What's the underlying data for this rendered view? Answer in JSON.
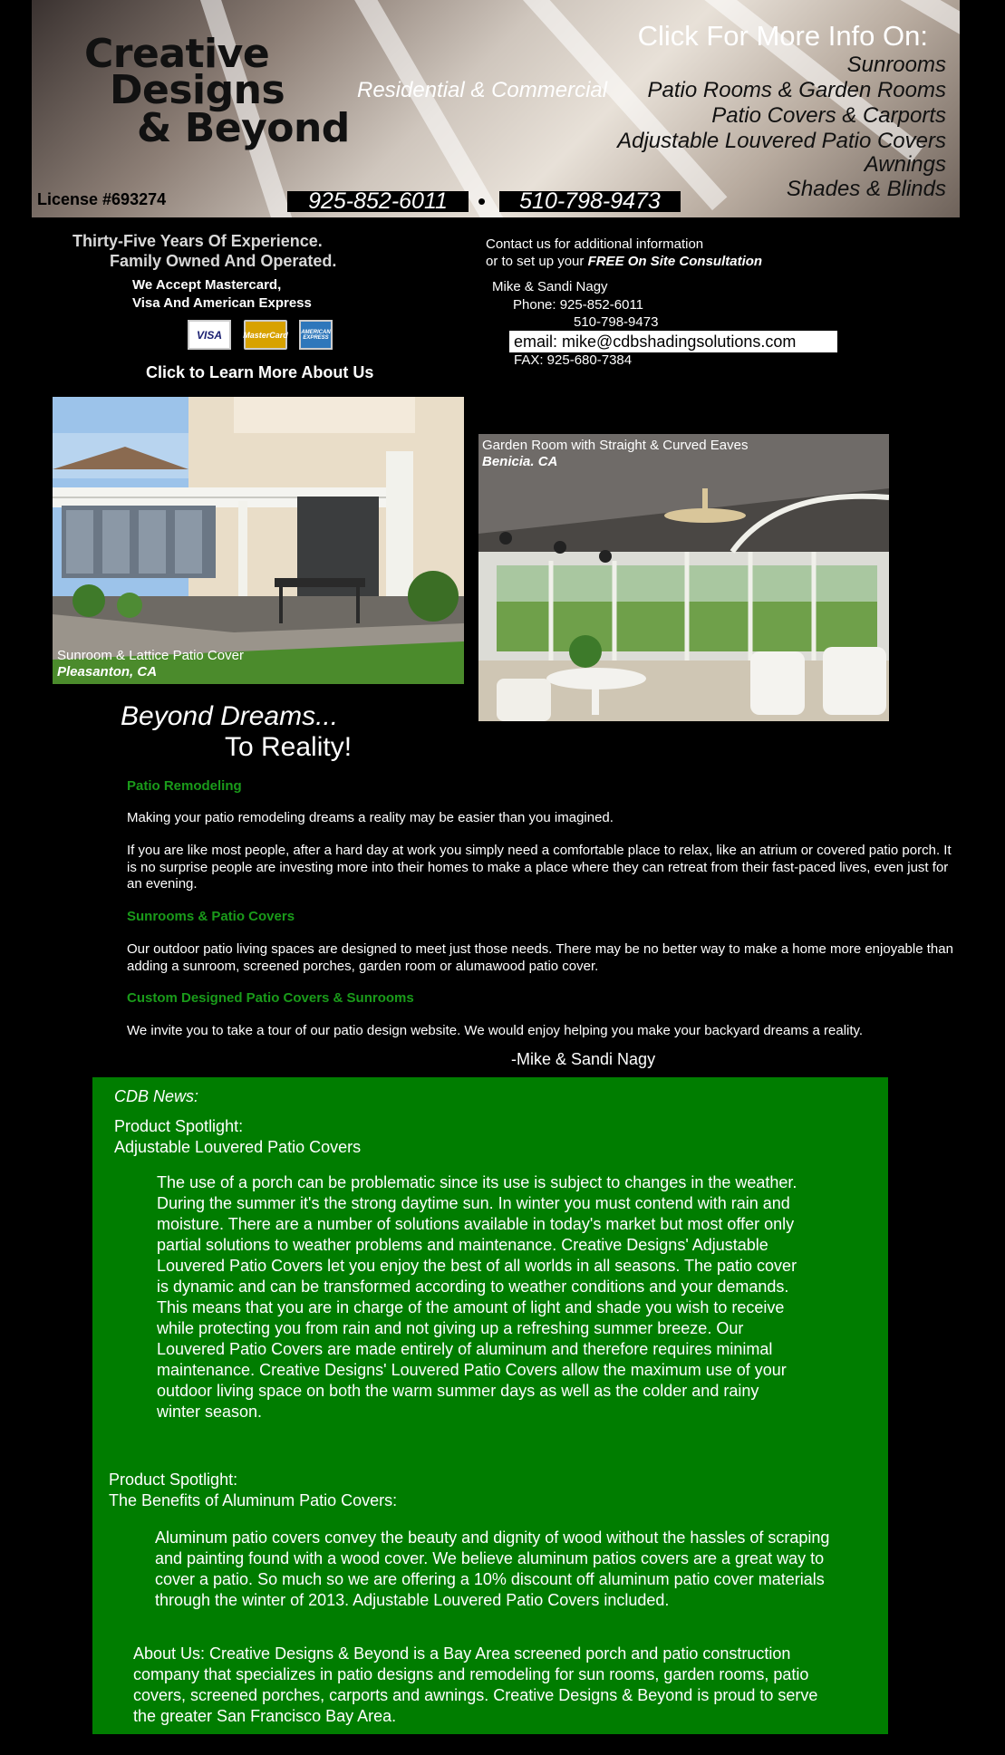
{
  "header": {
    "logo_line1": "Creative",
    "logo_line2": "Designs",
    "logo_line3": "& Beyond",
    "tagline": "Residential & Commercial",
    "more_info_title": "Click For More Info On:",
    "more_info_items": [
      "Sunrooms",
      "Patio Rooms & Garden Rooms",
      "Patio Covers & Carports",
      "Adjustable Louvered Patio Covers",
      "Awnings",
      "Shades & Blinds"
    ],
    "license": "License #693274",
    "phone1": "925-852-6011",
    "phone2": "510-798-9473",
    "separator": "•"
  },
  "intro": {
    "experience_line1": "Thirty-Five Years Of Experience.",
    "experience_line2": "Family Owned And Operated.",
    "cards_line1": "We Accept Mastercard,",
    "cards_line2": "Visa And American Express",
    "cards": [
      "VISA",
      "MasterCard",
      "AMERICAN EXPRESS"
    ],
    "about_link": "Click to Learn More About Us"
  },
  "contact": {
    "line1": "Contact us for additional information",
    "line2_prefix": "or to set up your ",
    "line2_em": "FREE On Site Consultation",
    "names": "Mike & Sandi Nagy",
    "phone_label": "Phone: 925-852-6011",
    "phone_second": "510-798-9473",
    "email": "email: mike@cdbshadingsolutions.com",
    "fax": "FAX:  925-680-7384"
  },
  "photos": {
    "left_caption": "Sunroom & Lattice Patio Cover",
    "left_location": "Pleasanton, CA",
    "right_caption": "Garden Room with Straight & Curved Eaves",
    "right_location": "Benicia. CA"
  },
  "slogan": {
    "line1": "Beyond Dreams...",
    "line2": "To Reality!"
  },
  "content": {
    "heading1": "Patio Remodeling",
    "para1": "Making your patio remodeling dreams a reality may be easier than you imagined.",
    "para2": "If you are like most people, after a hard day at work you simply need a comfortable place to relax, like an atrium or covered patio porch. It is no surprise people are investing more into their homes to make a place where they can retreat from their fast-paced lives, even just for an evening.",
    "heading2": "Sunrooms & Patio Covers",
    "para3": "Our outdoor patio living spaces are designed to meet just those needs. There may be no better way to make a home more enjoyable than adding a sunroom, screened porches, garden room or alumawood patio cover.",
    "heading3": "Custom Designed Patio Covers & Sunrooms",
    "para4": "We invite you to take a tour of our patio design website. We would enjoy helping you make your backyard dreams a reality.",
    "signature": "-Mike & Sandi Nagy"
  },
  "news": {
    "title": "CDB News:",
    "spot1_line1": "Product Spotlight:",
    "spot1_line2": "Adjustable Louvered Patio Covers",
    "spot1_body": "The use of a porch can be problematic since its use is subject to changes in the weather. During the summer it's the strong daytime sun. In winter you must contend with rain and moisture. There are a number of solutions available in today's market but most offer only partial solutions to weather problems and maintenance. Creative Designs' Adjustable Louvered Patio Covers let you enjoy the best of all worlds in all seasons. The patio cover is dynamic and can be transformed according to weather conditions and your demands. This means that you are in charge of the amount of light and shade you wish to receive while protecting you from rain and not giving up a refreshing summer breeze. Our Louvered Patio Covers are made entirely of aluminum and therefore requires minimal maintenance. Creative Designs' Louvered Patio Covers allow the maximum use of your outdoor living space on both the warm summer days as well as the colder and rainy winter season.",
    "spot2_line1": "Product Spotlight:",
    "spot2_line2": "The Benefits of Aluminum Patio Covers:",
    "spot2_body": "Aluminum patio covers convey the beauty and dignity of wood without the hassles of scraping and painting found with a wood cover. We believe aluminum patios covers are a great way to cover a patio. So much so we are offering a 10% discount off aluminum patio cover materials through the winter of 2013. Adjustable Louvered Patio Covers included.",
    "about": "About Us: Creative Designs & Beyond is a Bay Area screened porch and patio construction company that specializes in patio designs and remodeling for sun rooms, garden rooms, patio covers, screened porches, carports and awnings. Creative Designs & Beyond is proud to serve the greater San Francisco Bay Area."
  },
  "colors": {
    "background": "#000000",
    "news_bg": "#007d00",
    "heading_green": "#1a9b1a"
  }
}
